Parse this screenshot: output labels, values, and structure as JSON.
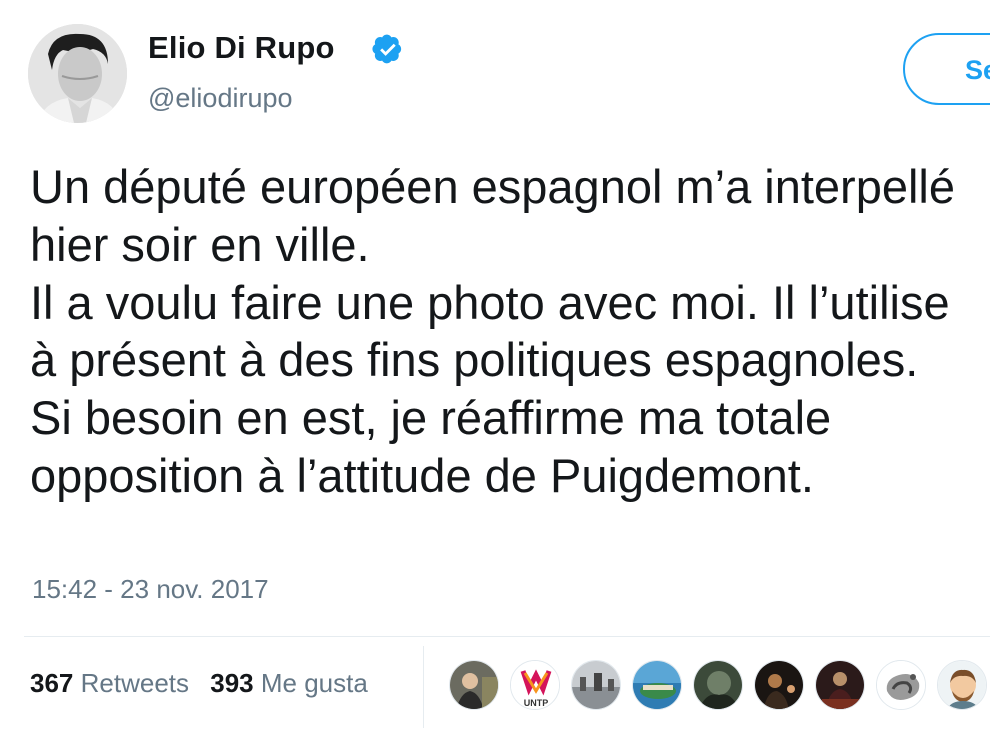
{
  "tweet": {
    "author": {
      "name": "Elio Di Rupo",
      "handle": "@eliodirupo",
      "verified_icon": "verified-badge-icon"
    },
    "follow_button_label": "Se",
    "text_lines": [
      "Un député européen espagnol m’a interpellé",
      "hier soir en ville.",
      "Il a voulu faire une photo avec moi. Il l’utilise",
      "à présent à des fins politiques espagnoles.",
      "Si besoin en est, je réaffirme ma totale",
      "opposition à l’attitude de Puigdemont."
    ],
    "timestamp": "15:42 - 23 nov. 2017",
    "stats": {
      "retweets_count": "367",
      "retweets_label": "Retweets",
      "likes_count": "393",
      "likes_label": "Me gusta"
    },
    "liked_by_avatars": [
      "liker-avatar-1",
      "liker-avatar-2",
      "liker-avatar-3",
      "liker-avatar-4",
      "liker-avatar-5",
      "liker-avatar-6",
      "liker-avatar-7",
      "liker-avatar-8",
      "liker-avatar-9"
    ],
    "liker_logo_text": "UNTP"
  },
  "colors": {
    "text": "#14171a",
    "secondary": "#657786",
    "accent": "#1da1f2",
    "divider": "#e6ecf0"
  }
}
